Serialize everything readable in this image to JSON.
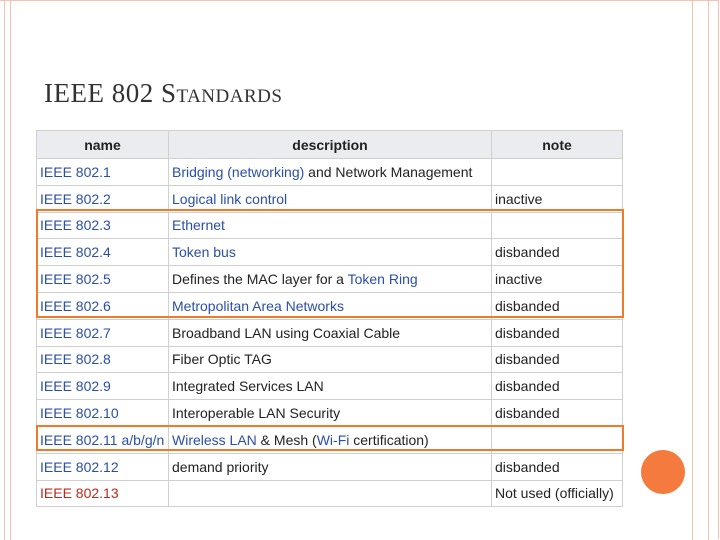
{
  "slide": {
    "title_lead": "IEEE 802 S",
    "title_rest": "TANDARDS"
  },
  "table": {
    "headers": [
      "name",
      "description",
      "note"
    ],
    "rows": [
      {
        "name": "IEEE 802.1",
        "name_red": false,
        "desc": [
          {
            "t": "Bridging (networking)",
            "link": true
          },
          {
            "t": " and Network Management",
            "link": false
          }
        ],
        "note": ""
      },
      {
        "name": "IEEE 802.2",
        "name_red": false,
        "desc": [
          {
            "t": "Logical link control",
            "link": true
          }
        ],
        "note": "inactive"
      },
      {
        "name": "IEEE 802.3",
        "name_red": false,
        "desc": [
          {
            "t": "Ethernet",
            "link": true
          }
        ],
        "note": ""
      },
      {
        "name": "IEEE 802.4",
        "name_red": false,
        "desc": [
          {
            "t": "Token bus",
            "link": true
          }
        ],
        "note": "disbanded"
      },
      {
        "name": "IEEE 802.5",
        "name_red": false,
        "desc": [
          {
            "t": "Defines the MAC layer for a ",
            "link": false
          },
          {
            "t": "Token Ring",
            "link": true
          }
        ],
        "note": "inactive"
      },
      {
        "name": "IEEE 802.6",
        "name_red": false,
        "desc": [
          {
            "t": "Metropolitan Area Networks",
            "link": true
          }
        ],
        "note": "disbanded"
      },
      {
        "name": "IEEE 802.7",
        "name_red": false,
        "desc": [
          {
            "t": "Broadband LAN using Coaxial Cable",
            "link": false
          }
        ],
        "note": "disbanded"
      },
      {
        "name": "IEEE 802.8",
        "name_red": false,
        "desc": [
          {
            "t": "Fiber Optic TAG",
            "link": false
          }
        ],
        "note": "disbanded"
      },
      {
        "name": "IEEE 802.9",
        "name_red": false,
        "desc": [
          {
            "t": "Integrated Services LAN",
            "link": false
          }
        ],
        "note": "disbanded"
      },
      {
        "name": "IEEE 802.10",
        "name_red": false,
        "desc": [
          {
            "t": "Interoperable LAN Security",
            "link": false
          }
        ],
        "note": "disbanded"
      },
      {
        "name": "IEEE 802.11 a/b/g/n",
        "name_red": false,
        "desc": [
          {
            "t": "Wireless LAN",
            "link": true
          },
          {
            "t": " & Mesh (",
            "link": false
          },
          {
            "t": "Wi-Fi",
            "link": true
          },
          {
            "t": " certification)",
            "link": false
          }
        ],
        "note": ""
      },
      {
        "name": "IEEE 802.12",
        "name_red": false,
        "desc": [
          {
            "t": "demand priority",
            "link": false
          }
        ],
        "note": "disbanded"
      },
      {
        "name": "IEEE 802.13",
        "name_red": true,
        "desc": [],
        "note": "Not used (officially)"
      }
    ]
  },
  "colors": {
    "link": "#2a4fa8",
    "redlink": "#ba2a1c",
    "highlight": "#ef7a2a",
    "accent_dot": "#f47a3e"
  }
}
